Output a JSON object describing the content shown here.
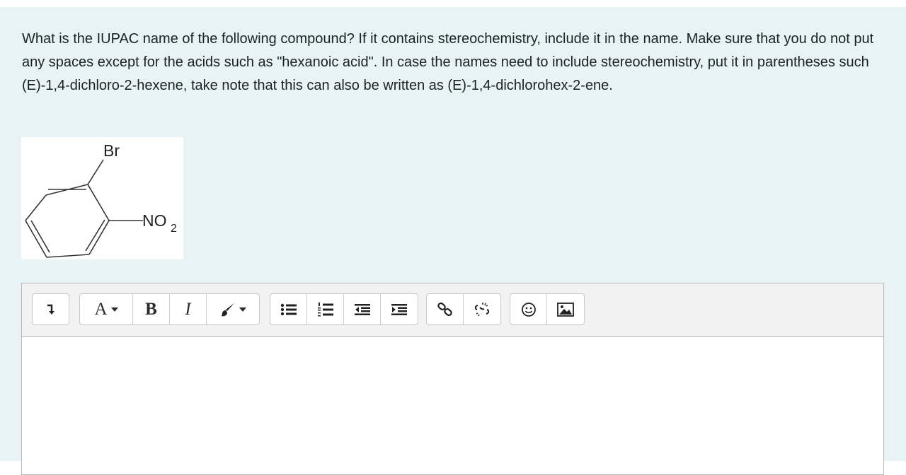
{
  "question": {
    "text": "What is the IUPAC name of the following compound? If it contains stereochemistry, include it in the name. Make sure that you do not put any spaces except for the acids such as \"hexanoic acid\". In case the names need to include stereochemistry, put it in parentheses such (E)-1,4-dichloro-2-hexene, take note that this can also be written as (E)-1,4-dichlorohex-2-ene."
  },
  "compound": {
    "substituent_top": "Br",
    "substituent_right_main": "NO",
    "substituent_right_sub": "2"
  },
  "toolbar": {
    "format_label": "A",
    "bold_label": "B",
    "italic_label": "I"
  },
  "icons": {
    "collapse": "collapse-arrow-icon",
    "font": "font-style-icon",
    "bold": "bold-icon",
    "italic": "italic-icon",
    "color": "paintbrush-icon",
    "ul": "unordered-list-icon",
    "ol": "ordered-list-icon",
    "outdent": "outdent-icon",
    "indent": "indent-icon",
    "link": "link-icon",
    "unlink": "unlink-icon",
    "emoji": "emoji-icon",
    "image": "image-icon"
  },
  "colors": {
    "panel_background": "#e7f3f5",
    "toolbar_background": "#f2f2f2",
    "text": "#1d2125"
  }
}
